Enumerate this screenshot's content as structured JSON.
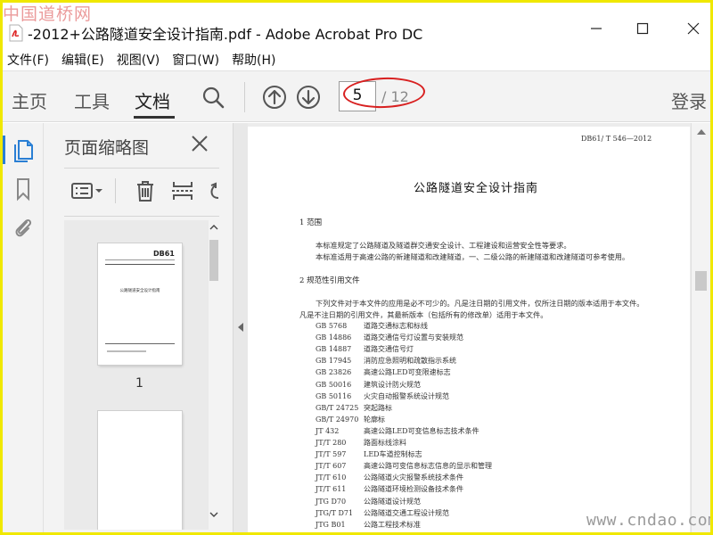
{
  "watermark_top": "中国道桥网",
  "watermark_bottom": "www.cndao.com",
  "window": {
    "title": "-2012+公路隧道安全设计指南.pdf - Adobe Acrobat Pro DC"
  },
  "menu": [
    "文件(F)",
    "编辑(E)",
    "视图(V)",
    "窗口(W)",
    "帮助(H)"
  ],
  "toolbar": {
    "tabs": [
      "主页",
      "工具",
      "文档"
    ],
    "active_tab": "文档",
    "page_current": "5",
    "page_total": "/ 12",
    "login": "登录"
  },
  "panel": {
    "title": "页面缩略图",
    "thumb_label": "1",
    "thumb_doc_number": "DB61",
    "thumb_doc_title": "公路隧道安全设计指南"
  },
  "document": {
    "header_code": "DB61/ T 546—2012",
    "title": "公路隧道安全设计指南",
    "section1_heading": "1  范围",
    "section1_lines": [
      "本标准规定了公路隧道及隧道群交通安全设计、工程建设和运营安全性等要求。",
      "本标准适用于高速公路的新建隧道和改建隧道，一、二级公路的新建隧道和改建隧道可参考使用。"
    ],
    "section2_heading": "2  规范性引用文件",
    "section2_lines": [
      "下列文件对于本文件的应用是必不可少的。凡是注日期的引用文件，仅所注日期的版本适用于本文件。",
      "凡是不注日期的引用文件，其最新版本（包括所有的修改单）适用于本文件。"
    ],
    "references": [
      {
        "code": "GB 5768",
        "name": "道路交通标志和标线"
      },
      {
        "code": "GB 14886",
        "name": "道路交通信号灯设置与安装规范"
      },
      {
        "code": "GB 14887",
        "name": "道路交通信号灯"
      },
      {
        "code": "GB 17945",
        "name": "消防应急照明和疏散指示系统"
      },
      {
        "code": "GB 23826",
        "name": "高速公路LED可变限速标志"
      },
      {
        "code": "GB 50016",
        "name": "建筑设计防火规范"
      },
      {
        "code": "GB 50116",
        "name": "火灾自动报警系统设计规范"
      },
      {
        "code": "GB/T 24725",
        "name": "突起路标"
      },
      {
        "code": "GB/T 24970",
        "name": "轮廓标"
      },
      {
        "code": "JT 432",
        "name": "高速公路LED可变信息标志技术条件"
      },
      {
        "code": "JT/T 280",
        "name": "路面标线涂料"
      },
      {
        "code": "JT/T 597",
        "name": "LED车道控制标志"
      },
      {
        "code": "JT/T 607",
        "name": "高速公路可变信息标志信息的显示和管理"
      },
      {
        "code": "JT/T 610",
        "name": "公路隧道火灾报警系统技术条件"
      },
      {
        "code": "JT/T 611",
        "name": "公路隧道环境检测设备技术条件"
      },
      {
        "code": "JTG D70",
        "name": "公路隧道设计规范"
      },
      {
        "code": "JTG/T D71",
        "name": "公路隧道交通工程设计规范"
      },
      {
        "code": "JTG B01",
        "name": "公路工程技术标准"
      }
    ]
  },
  "colors": {
    "frame_border": "#f0e800",
    "accent": "#2a7fd4",
    "annotation": "#d82020"
  },
  "icons": [
    "pdf-file-icon",
    "minimize-icon",
    "maximize-icon",
    "close-icon",
    "search-icon",
    "arrow-up-circle-icon",
    "arrow-down-circle-icon",
    "page-thumbnails-icon",
    "bookmark-icon",
    "attachment-icon",
    "options-icon",
    "delete-icon",
    "insert-page-icon",
    "rotate-icon"
  ]
}
